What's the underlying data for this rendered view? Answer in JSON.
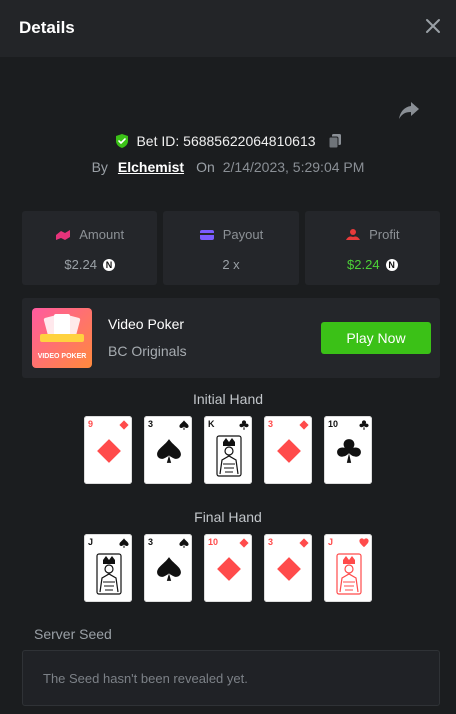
{
  "header": {
    "title": "Details"
  },
  "bet": {
    "id_text": "Bet ID: 56885622064810613",
    "by_label": "By",
    "username": "Elchemist",
    "on_label": "On",
    "datetime": "2/14/2023, 5:29:04 PM"
  },
  "stats": {
    "amount": {
      "label": "Amount",
      "value": "$2.24",
      "icon": "amount-icon"
    },
    "payout": {
      "label": "Payout",
      "value": "2 x",
      "icon": "wallet-icon"
    },
    "profit": {
      "label": "Profit",
      "value": "$2.24",
      "icon": "profit-icon"
    },
    "currency_glyph": "N"
  },
  "game": {
    "name": "Video Poker",
    "provider": "BC Originals",
    "thumb_label": "VIDEO POKER",
    "play_label": "Play Now"
  },
  "initial_hand": {
    "title": "Initial Hand",
    "cards": [
      {
        "rank": "9",
        "suit": "diamond",
        "face": false
      },
      {
        "rank": "3",
        "suit": "spade",
        "face": false
      },
      {
        "rank": "K",
        "suit": "club",
        "face": true
      },
      {
        "rank": "3",
        "suit": "diamond",
        "face": false
      },
      {
        "rank": "10",
        "suit": "club",
        "face": false
      }
    ]
  },
  "final_hand": {
    "title": "Final Hand",
    "cards": [
      {
        "rank": "J",
        "suit": "spade",
        "face": true
      },
      {
        "rank": "3",
        "suit": "spade",
        "face": false
      },
      {
        "rank": "10",
        "suit": "diamond",
        "face": false
      },
      {
        "rank": "3",
        "suit": "diamond",
        "face": false
      },
      {
        "rank": "J",
        "suit": "heart",
        "face": true
      }
    ]
  },
  "seed": {
    "label": "Server Seed",
    "message": "The Seed hasn't been revealed yet."
  },
  "colors": {
    "accent_green": "#3bc117",
    "profit_green": "#4cd137",
    "card_red": "#ff4b4b",
    "amount_pink": "#e6337a",
    "payout_purple": "#7b5cff",
    "profit_red": "#e83a3a"
  }
}
